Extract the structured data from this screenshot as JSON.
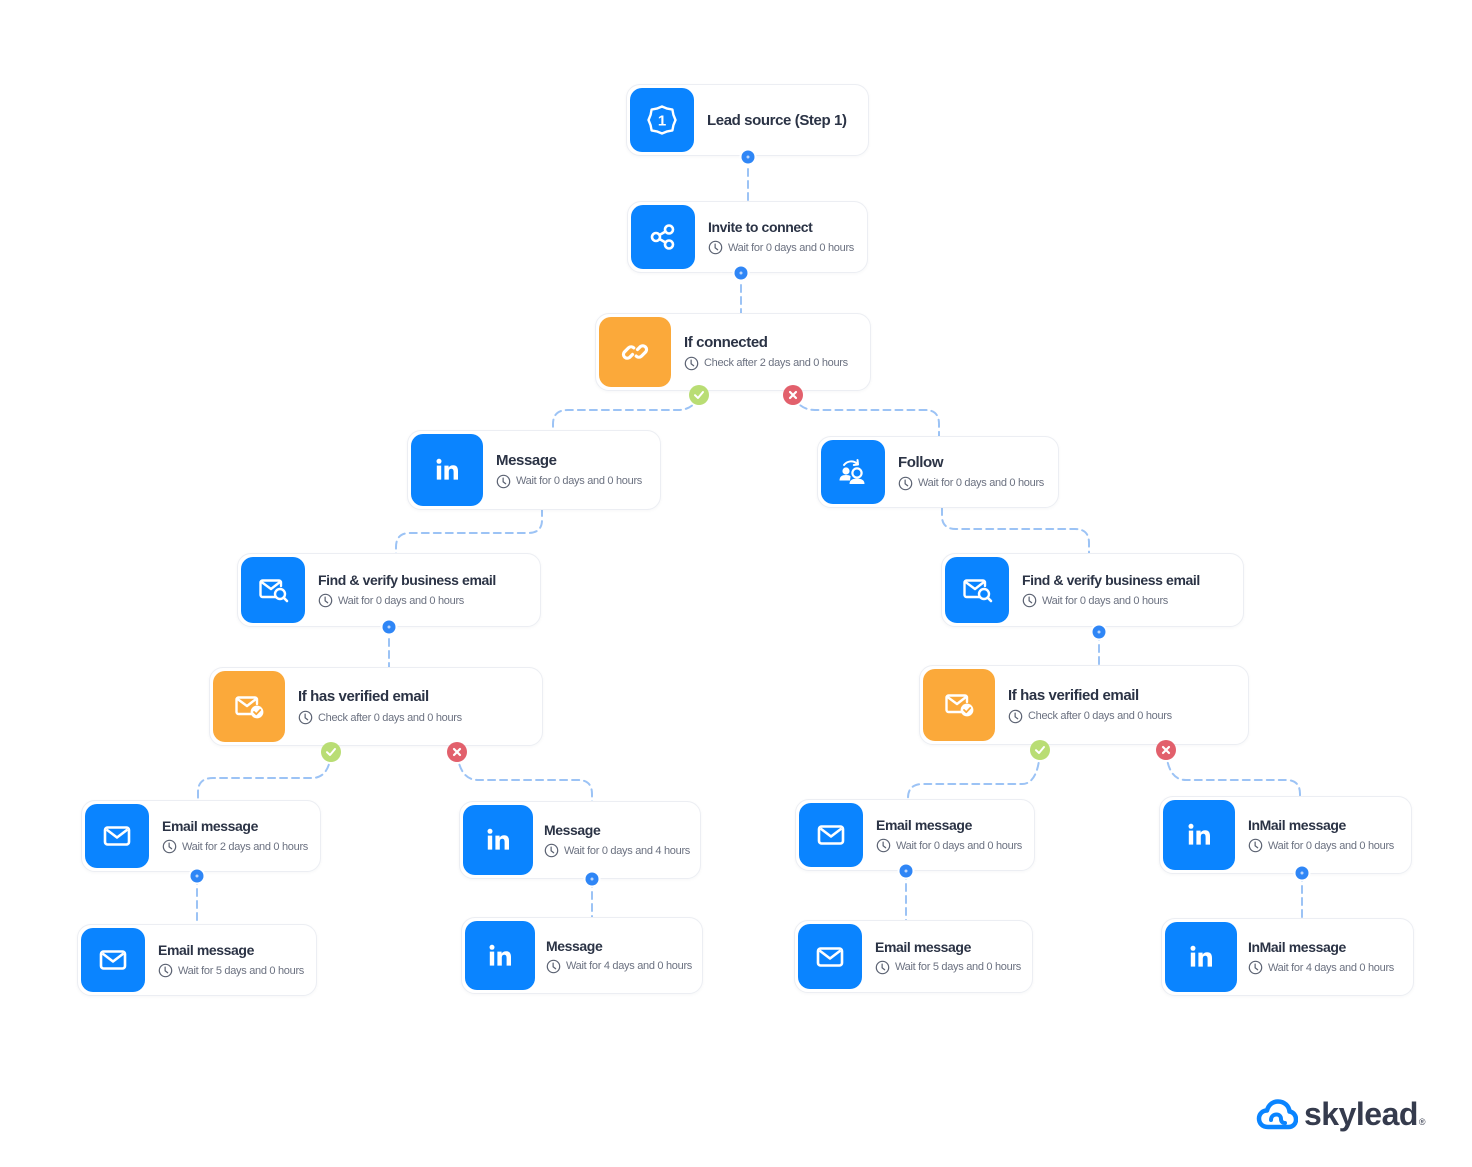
{
  "diagram": {
    "type": "automation-workflow",
    "brand": {
      "name": "skylead",
      "registered_mark": "®"
    },
    "colors": {
      "action": "#0a84ff",
      "condition": "#fba93a",
      "yes_badge": "#b9dd74",
      "no_badge": "#e2606c",
      "connector": "#9cc3f5",
      "dot": "#2f86f6",
      "title_text": "#2b3345",
      "sub_text": "#6b7180"
    },
    "nodes": [
      {
        "id": "lead-source",
        "kind": "action",
        "icon": "step-1-badge-icon",
        "icon_text": "1",
        "title": "Lead source (Step 1)",
        "sub": ""
      },
      {
        "id": "invite",
        "kind": "action",
        "icon": "share-nodes-icon",
        "title": "Invite to connect",
        "sub": "Wait for 0 days and 0 hours"
      },
      {
        "id": "if-connected",
        "kind": "condition",
        "icon": "link-icon",
        "title": "If connected",
        "sub": "Check after 2 days and 0 hours"
      },
      {
        "id": "message-l",
        "kind": "action",
        "icon": "linkedin-icon",
        "title": "Message",
        "sub": "Wait for 0 days and 0 hours"
      },
      {
        "id": "follow",
        "kind": "action",
        "icon": "follow-users-icon",
        "title": "Follow",
        "sub": "Wait for 0 days and 0 hours"
      },
      {
        "id": "find-l",
        "kind": "action",
        "icon": "email-search-icon",
        "title": "Find & verify business email",
        "sub": "Wait for 0 days and 0 hours"
      },
      {
        "id": "find-r",
        "kind": "action",
        "icon": "email-search-icon",
        "title": "Find & verify business email",
        "sub": "Wait for 0 days and 0 hours"
      },
      {
        "id": "ifemail-l",
        "kind": "condition",
        "icon": "email-verified-icon",
        "title": "If has verified email",
        "sub": "Check after 0 days and 0 hours"
      },
      {
        "id": "ifemail-r",
        "kind": "condition",
        "icon": "email-verified-icon",
        "title": "If has verified email",
        "sub": "Check after 0 days and 0 hours"
      },
      {
        "id": "email-1",
        "kind": "action",
        "icon": "envelope-icon",
        "title": "Email message",
        "sub": "Wait for 2 days and 0 hours"
      },
      {
        "id": "email-2",
        "kind": "action",
        "icon": "envelope-icon",
        "title": "Email message",
        "sub": "Wait for 5 days and 0 hours"
      },
      {
        "id": "msg-b1",
        "kind": "action",
        "icon": "linkedin-icon",
        "title": "Message",
        "sub": "Wait for 0 days and 4 hours"
      },
      {
        "id": "msg-b2",
        "kind": "action",
        "icon": "linkedin-icon",
        "title": "Message",
        "sub": "Wait for 4 days and 0 hours"
      },
      {
        "id": "email-r1",
        "kind": "action",
        "icon": "envelope-icon",
        "title": "Email message",
        "sub": "Wait for 0 days and 0 hours"
      },
      {
        "id": "email-r2",
        "kind": "action",
        "icon": "envelope-icon",
        "title": "Email message",
        "sub": "Wait for 5 days and 0 hours"
      },
      {
        "id": "inmail-1",
        "kind": "action",
        "icon": "linkedin-icon",
        "title": "InMail message",
        "sub": "Wait for 0 days and 0 hours"
      },
      {
        "id": "inmail-2",
        "kind": "action",
        "icon": "linkedin-icon",
        "title": "InMail message",
        "sub": "Wait for 4 days and 0 hours"
      }
    ],
    "edges": [
      {
        "from": "lead-source",
        "to": "invite",
        "branch": "next"
      },
      {
        "from": "invite",
        "to": "if-connected",
        "branch": "next"
      },
      {
        "from": "if-connected",
        "to": "message-l",
        "branch": "yes"
      },
      {
        "from": "if-connected",
        "to": "follow",
        "branch": "no"
      },
      {
        "from": "message-l",
        "to": "find-l",
        "branch": "next"
      },
      {
        "from": "follow",
        "to": "find-r",
        "branch": "next"
      },
      {
        "from": "find-l",
        "to": "ifemail-l",
        "branch": "next"
      },
      {
        "from": "find-r",
        "to": "ifemail-r",
        "branch": "next"
      },
      {
        "from": "ifemail-l",
        "to": "email-1",
        "branch": "yes"
      },
      {
        "from": "ifemail-l",
        "to": "msg-b1",
        "branch": "no"
      },
      {
        "from": "ifemail-r",
        "to": "email-r1",
        "branch": "yes"
      },
      {
        "from": "ifemail-r",
        "to": "inmail-1",
        "branch": "no"
      },
      {
        "from": "email-1",
        "to": "email-2",
        "branch": "next"
      },
      {
        "from": "msg-b1",
        "to": "msg-b2",
        "branch": "next"
      },
      {
        "from": "email-r1",
        "to": "email-r2",
        "branch": "next"
      },
      {
        "from": "inmail-1",
        "to": "inmail-2",
        "branch": "next"
      }
    ]
  }
}
